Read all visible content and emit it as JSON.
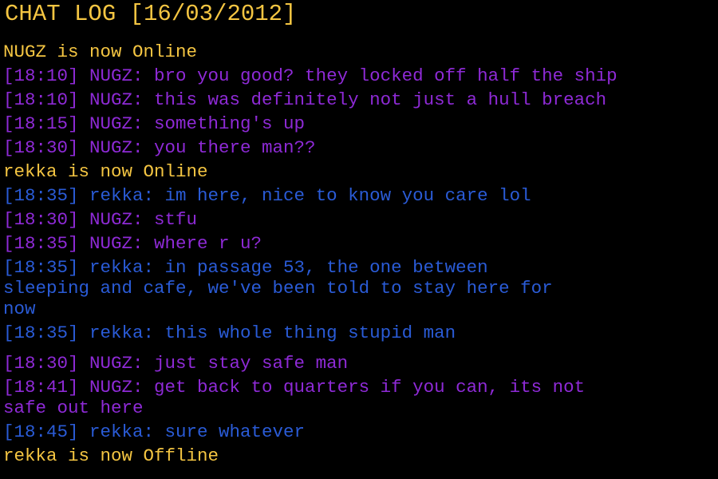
{
  "title": "CHAT LOG [16/03/2012]",
  "colors": {
    "background": "#000000",
    "status": "#f4c542",
    "nugz": "#8e2ad6",
    "rekka": "#2a5bd6"
  },
  "messages": [
    "NUGZ is now Online",
    "[18:10] NUGZ: bro you good? they locked off half the ship",
    "[18:10] NUGZ: this was definitely not just a hull breach",
    "[18:15] NUGZ: something's up",
    "[18:30] NUGZ: you there man??",
    "rekka is now Online",
    "[18:35] rekka: im here, nice to know you care lol",
    "[18:30] NUGZ: stfu",
    "[18:35] NUGZ: where r u?",
    "[18:35] rekka: in passage 53, the one between",
    "sleeping and cafe, we've been told to stay here for",
    "now",
    "[18:35] rekka: this whole thing stupid man",
    "[18:30] NUGZ: just stay safe man",
    "[18:41] NUGZ: get back to quarters if you can, its not",
    "safe out here",
    "[18:45] rekka: sure whatever",
    "rekka is now Offline"
  ]
}
